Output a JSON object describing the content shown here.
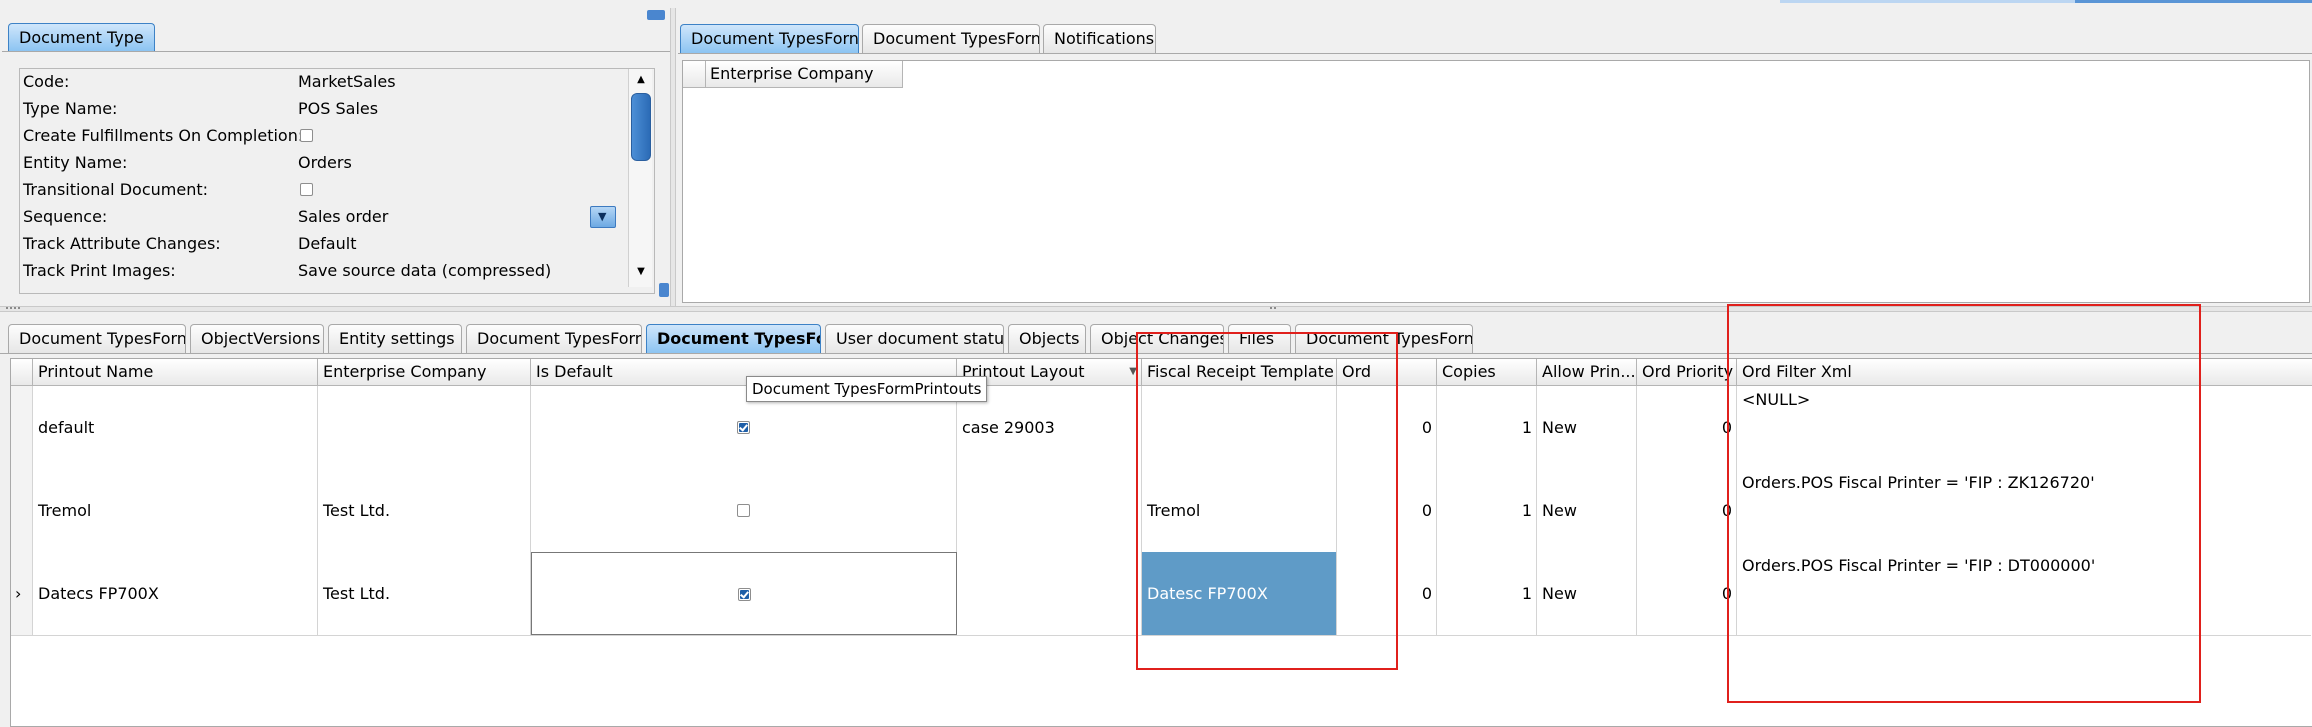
{
  "top_left": {
    "tab": "Document Type",
    "fields": [
      {
        "label": "Code:",
        "value": "MarketSales",
        "type": "text"
      },
      {
        "label": "Type Name:",
        "value": "POS Sales",
        "type": "text"
      },
      {
        "label": "Create Fulfillments On Completion:",
        "value": "",
        "type": "checkbox",
        "checked": false
      },
      {
        "label": "Entity Name:",
        "value": "Orders",
        "type": "text"
      },
      {
        "label": "Transitional Document:",
        "value": "",
        "type": "checkbox",
        "checked": false
      },
      {
        "label": "Sequence:",
        "value": "Sales order",
        "type": "dropdown"
      },
      {
        "label": "Track Attribute Changes:",
        "value": "Default",
        "type": "text"
      },
      {
        "label": "Track Print Images:",
        "value": "Save source data (compressed)",
        "type": "text"
      }
    ]
  },
  "top_right": {
    "tabs": [
      "Document TypesForn",
      "Document TypesForn",
      "Notifications"
    ],
    "active_tab": 0,
    "column": "Enterprise Company"
  },
  "bottom": {
    "tabs": [
      "Document TypesForn",
      "ObjectVersions",
      "Entity settings",
      "Document TypesForn",
      "Document TypesFo",
      "User document status",
      "Objects",
      "Object Changes",
      "Files",
      "Document TypesForn"
    ],
    "active_tab": 4,
    "tooltip": "Document TypesFormPrintouts",
    "columns": [
      "Printout Name",
      "Enterprise Company",
      "Is Default",
      "Printout Layout",
      "Fiscal Receipt Template",
      "Ord",
      "Copies",
      "Allow Prin...",
      "Ord Priority",
      "Ord Filter Xml"
    ],
    "rows": [
      {
        "name": "default",
        "company": "",
        "is_default": true,
        "layout": "case 29003",
        "fiscal": "",
        "ord": "0",
        "copies": "1",
        "allow": "New",
        "priority": "0",
        "filter": "<NULL>",
        "current": false
      },
      {
        "name": "Tremol",
        "company": "Test Ltd.",
        "is_default": false,
        "layout": "",
        "fiscal": "Tremol",
        "ord": "0",
        "copies": "1",
        "allow": "New",
        "priority": "0",
        "filter": "Orders.POS Fiscal Printer = 'FIP : ZK126720'",
        "current": false
      },
      {
        "name": "Datecs FP700X",
        "company": "Test Ltd.",
        "is_default": true,
        "layout": "",
        "fiscal": "Datesc FP700X",
        "ord": "0",
        "copies": "1",
        "allow": "New",
        "priority": "0",
        "filter": "Orders.POS Fiscal Printer = 'FIP : DT000000'",
        "current": true
      }
    ],
    "current_row_marker": "›"
  },
  "colors": {
    "active_tab": "#8cc4f2",
    "selected_cell": "#5f9bc7",
    "annotation": "#e0201c"
  }
}
